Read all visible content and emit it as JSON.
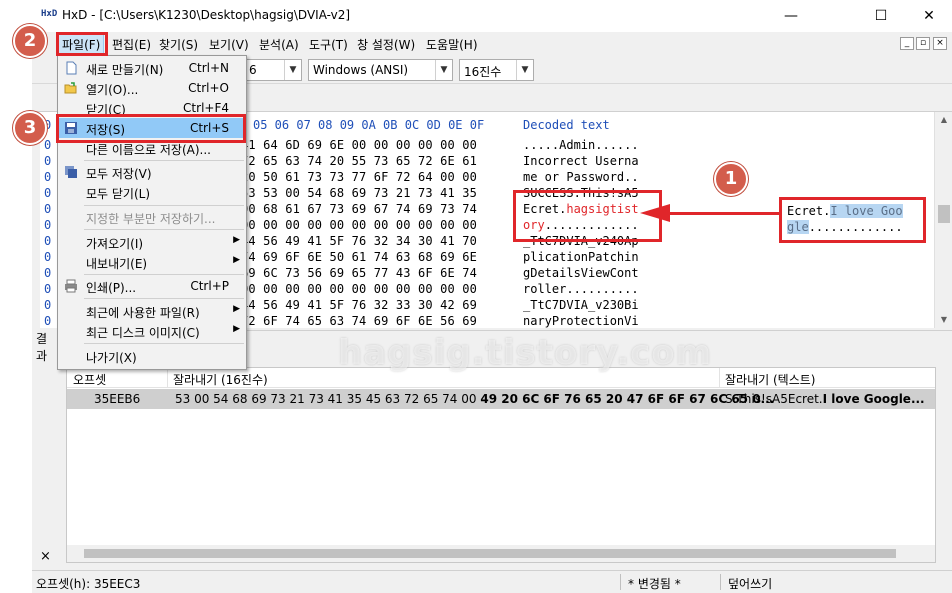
{
  "window": {
    "title": "HxD - [C:\\Users\\K1230\\Desktop\\hagsig\\DVIA-v2]",
    "app_icon": "HxD",
    "minimize": "—",
    "maximize": "☐",
    "close": "✕"
  },
  "menubar": {
    "items": [
      "파일(F)",
      "편집(E)",
      "찾기(S)",
      "보기(V)",
      "분석(A)",
      "도구(T)",
      "창 설정(W)",
      "도움말(H)"
    ],
    "mdi_buttons": [
      "_",
      "▫",
      "×"
    ]
  },
  "toolbar": {
    "bytes_per_row": "6",
    "charset": "Windows (ANSI)",
    "offset_base": "16진수"
  },
  "hex_view": {
    "column_header": "05 06 07 08 09 0A 0B 0C 0D 0E 0F",
    "text_header": "Decoded text",
    "offset_header": "0",
    "rows": [
      {
        "off": "0",
        "hex": "41 64 6D 69 6E 00 00 00 00 00 00",
        "txt": ".....Admin......"
      },
      {
        "off": "0",
        "hex": "72 65 63 74 20 55 73 65 72 6E 61",
        "txt": "Incorrect Userna"
      },
      {
        "off": "0",
        "hex": "20 50 61 73 73 77 6F 72 64 00 00",
        "txt": "me or Password.."
      },
      {
        "off": "0",
        "hex": "53 53 00 54 68 69 73 21 73 41 35",
        "txt": "SUCCESS.This!sA5"
      },
      {
        "off": "0",
        "hex": "00 68 61 67 73 69 67 74 69 73 74",
        "txt_pre": "Ecret.",
        "txt_red": "hagsigtist"
      },
      {
        "off": "0",
        "hex": "00 00 00 00 00 00 00 00 00 00 00",
        "txt_red": "ory",
        "txt_post": "............."
      },
      {
        "off": "0",
        "hex": "44 56 49 41 5F 76 32 34 30 41 70",
        "txt": "_TtC7DVIA_v240Ap"
      },
      {
        "off": "0",
        "hex": "74 69 6F 6E 50 61 74 63 68 69 6E",
        "txt": "plicationPatchin"
      },
      {
        "off": "0",
        "hex": "69 6C 73 56 69 65 77 43 6F 6E 74",
        "txt": "gDetailsViewCont"
      },
      {
        "off": "0",
        "hex": "00 00 00 00 00 00 00 00 00 00 00",
        "txt": "roller.........."
      },
      {
        "off": "0",
        "hex": "44 56 49 41 5F 76 32 33 30 42 69",
        "txt": "_TtC7DVIA_v230Bi"
      },
      {
        "off": "0",
        "hex": "72 6F 74 65 63 74 69 6F 6E 56 69",
        "txt": "naryProtectionVi"
      }
    ]
  },
  "callout": {
    "line1_pre": "Ecret.",
    "line1_sel": "I love Goo",
    "line2_sel": "gle",
    "line2_post": "............."
  },
  "file_menu": {
    "items": [
      {
        "label": "새로 만들기(N)",
        "shortcut": "Ctrl+N",
        "icon": "new-file-icon"
      },
      {
        "label": "열기(O)...",
        "shortcut": "Ctrl+O",
        "icon": "open-folder-icon"
      },
      {
        "label": "닫기(C)",
        "shortcut": "Ctrl+F4"
      },
      {
        "label": "저장(S)",
        "shortcut": "Ctrl+S",
        "icon": "save-disk-icon"
      },
      {
        "label": "다른 이름으로 저장(A)..."
      },
      {
        "label": "모두 저장(V)",
        "icon": "save-all-icon"
      },
      {
        "label": "모두 닫기(L)"
      },
      {
        "label": "지정한 부분만 저장하기..."
      },
      {
        "label": "가져오기(I)"
      },
      {
        "label": "내보내기(E)"
      },
      {
        "label": "인쇄(P)...",
        "shortcut": "Ctrl+P",
        "icon": "printer-icon"
      },
      {
        "label": "최근에 사용한 파일(R)"
      },
      {
        "label": "최근 디스크 이미지(C)"
      },
      {
        "label": "나가기(X)"
      }
    ]
  },
  "results": {
    "side_label": "결과",
    "close_glyph": "×",
    "columns": [
      "오프셋",
      "잘라내기 (16진수)",
      "잘라내기 (텍스트)"
    ],
    "row": {
      "offset": "35EEB6",
      "hex_plain": "53 00 54 68 69 73 21 73 41 35 45 63 72 65 74 00 ",
      "hex_bold": "49 20 6C 6F 76 65 20 47 6F 6F 67 6C 65 0...",
      "text_plain": "S.This!sA5Ecret.",
      "text_bold": "I love Google..."
    }
  },
  "statusbar": {
    "offset": "오프셋(h): 35EEC3",
    "changed": "* 변경됨 *",
    "mode": "덮어쓰기"
  },
  "annotations": {
    "badge1": "1",
    "badge2": "2",
    "badge3": "3",
    "watermark": "hagsig.tistory.com",
    "accent_color": "#e0262a",
    "badge_color": "#d35d4c"
  }
}
